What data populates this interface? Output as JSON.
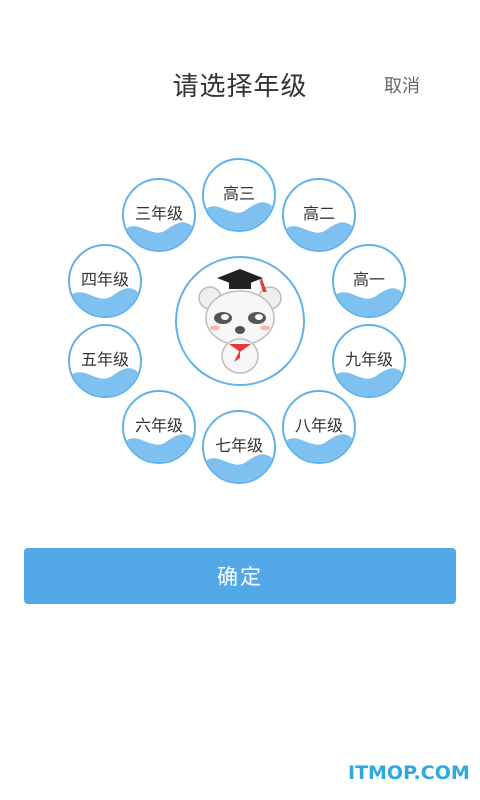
{
  "header": {
    "title": "请选择年级",
    "cancel_label": "取消"
  },
  "grades": [
    {
      "label": "高三"
    },
    {
      "label": "高二"
    },
    {
      "label": "高一"
    },
    {
      "label": "九年级"
    },
    {
      "label": "八年级"
    },
    {
      "label": "七年级"
    },
    {
      "label": "六年级"
    },
    {
      "label": "五年级"
    },
    {
      "label": "四年级"
    },
    {
      "label": "三年级"
    }
  ],
  "mascot": {
    "icon": "bear-graduation-cap-icon"
  },
  "footer": {
    "confirm_label": "确定"
  },
  "watermark": "ITMOP.COM",
  "colors": {
    "accent": "#53a8ea",
    "bubble_border": "#62b2ea",
    "wave": "#7ec0ef"
  }
}
